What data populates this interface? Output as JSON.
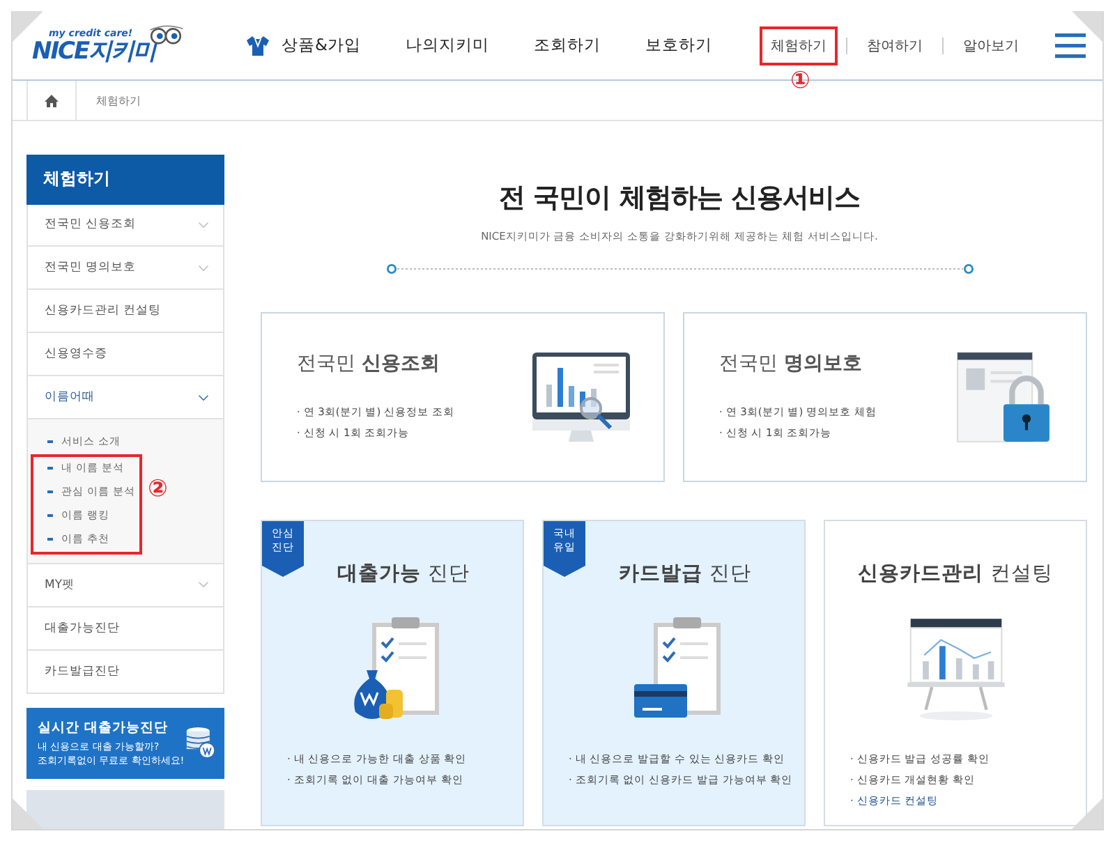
{
  "header": {
    "logo": {
      "tagline": "my credit care!",
      "name": "NICE지키미"
    },
    "nav": [
      {
        "label": "상품&가입"
      },
      {
        "label": "나의지키미"
      },
      {
        "label": "조회하기"
      },
      {
        "label": "보호하기"
      }
    ],
    "util_links": [
      {
        "label": "체험하기",
        "annotated": true
      },
      {
        "label": "참여하기",
        "annotated": false
      },
      {
        "label": "알아보기",
        "annotated": false
      }
    ],
    "annotation": "①"
  },
  "breadcrumb": [
    "체험하기"
  ],
  "sidebar": {
    "title": "체험하기",
    "items": [
      {
        "label": "전국민 신용조회",
        "expandable": true,
        "expanded": false
      },
      {
        "label": "전국민 명의보호",
        "expandable": true,
        "expanded": false
      },
      {
        "label": "신용카드관리 컨설팅",
        "expandable": false,
        "expanded": false
      },
      {
        "label": "신용영수증",
        "expandable": false,
        "expanded": false
      },
      {
        "label": "이름어때",
        "expandable": true,
        "expanded": true,
        "children": [
          {
            "label": "서비스 소개",
            "annotated": false
          },
          {
            "label": "내 이름 분석",
            "annotated": true
          },
          {
            "label": "관심 이름 분석",
            "annotated": true
          },
          {
            "label": "이름 랭킹",
            "annotated": true
          },
          {
            "label": "이름 추천",
            "annotated": true
          }
        ]
      },
      {
        "label": "MY펫",
        "expandable": true,
        "expanded": false
      },
      {
        "label": "대출가능진단",
        "expandable": false,
        "expanded": false
      },
      {
        "label": "카드발급진단",
        "expandable": false,
        "expanded": false
      }
    ],
    "annotation": "②",
    "banner": {
      "title": "실시간 대출가능진단",
      "lines": [
        "내 신용으로 대출 가능할까?",
        "조회기록없이 무료로 확인하세요!"
      ]
    }
  },
  "main": {
    "headline": "전 국민이 **체험하는** 신용서비스",
    "subtitle": "NICE지키미가 금융 소비자의 소통을 강화하기위해 제공하는 체험 서비스입니다.",
    "top_cards": [
      {
        "title": "전국민 **신용조회**",
        "kind": "monitor",
        "bullets": [
          "· 연 3회(분기 별) 신용정보 조회",
          "· 신청 시 1회 조회가능"
        ]
      },
      {
        "title": "전국민 **명의보호**",
        "kind": "lock",
        "bullets": [
          "· 연 3회(분기 별) 명의보호 체험",
          "· 신청 시 1회 조회가능"
        ]
      }
    ],
    "bottom_cards": [
      {
        "badge": "안심\n진단",
        "title": "**대출가능** 진단",
        "kind": "loan",
        "tinted": true,
        "bullets": [
          {
            "text": "· 내 신용으로 가능한 대출 상품 확인",
            "kind": "text"
          },
          {
            "text": "· 조회기록 없이 대출 가능여부 확인",
            "kind": "text"
          }
        ]
      },
      {
        "badge": "국내\n유일",
        "title": "**카드발급** 진단",
        "kind": "card",
        "tinted": true,
        "bullets": [
          {
            "text": "· 내 신용으로 발급할 수 있는 신용카드 확인",
            "kind": "text"
          },
          {
            "text": "· 조회기록 없이 신용카드 발급 가능여부 확인",
            "kind": "text"
          }
        ]
      },
      {
        "title": "**신용카드관리** 컨설팅",
        "kind": "board",
        "tinted": false,
        "bullets": [
          {
            "text": "· 신용카드 발급 성공률 확인",
            "kind": "text"
          },
          {
            "text": "· 신용카드 개설현황 확인",
            "kind": "text"
          },
          {
            "text": "· 신용카드 컨설팅",
            "kind": "link"
          }
        ]
      }
    ]
  }
}
